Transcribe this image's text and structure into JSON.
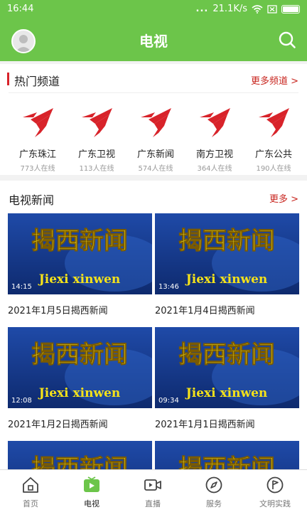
{
  "status_bar": {
    "time": "16:44",
    "dots": "...",
    "speed": "21.1K/s"
  },
  "header": {
    "title": "电视"
  },
  "hot_channels": {
    "title": "热门频道",
    "more_label": "更多频道 >",
    "channels": [
      {
        "name": "广东珠江",
        "viewers": "773人在线"
      },
      {
        "name": "广东卫视",
        "viewers": "113人在线"
      },
      {
        "name": "广东新闻",
        "viewers": "574人在线"
      },
      {
        "name": "南方卫视",
        "viewers": "364人在线"
      },
      {
        "name": "广东公共",
        "viewers": "190人在线"
      }
    ]
  },
  "tv_news": {
    "title": "电视新闻",
    "more_label": "更多 >",
    "thumbnail_text": {
      "cn": "揭西新闻",
      "pinyin": "Jiexi xinwen"
    },
    "videos": [
      {
        "title": "2021年1月5日揭西新闻",
        "duration": "14:15"
      },
      {
        "title": "2021年1月4日揭西新闻",
        "duration": "13:46"
      },
      {
        "title": "2021年1月2日揭西新闻",
        "duration": "12:08"
      },
      {
        "title": "2021年1月1日揭西新闻",
        "duration": "09:34"
      }
    ]
  },
  "bottom_nav": {
    "items": [
      {
        "label": "首页",
        "icon": "home-icon"
      },
      {
        "label": "电视",
        "icon": "tv-icon",
        "active": true
      },
      {
        "label": "直播",
        "icon": "live-camera-icon"
      },
      {
        "label": "服务",
        "icon": "compass-icon"
      },
      {
        "label": "文明实践",
        "icon": "flag-icon"
      }
    ]
  },
  "colors": {
    "brand_green": "#6cc54a",
    "accent_red": "#c8261f",
    "logo_red": "#d8232a"
  }
}
